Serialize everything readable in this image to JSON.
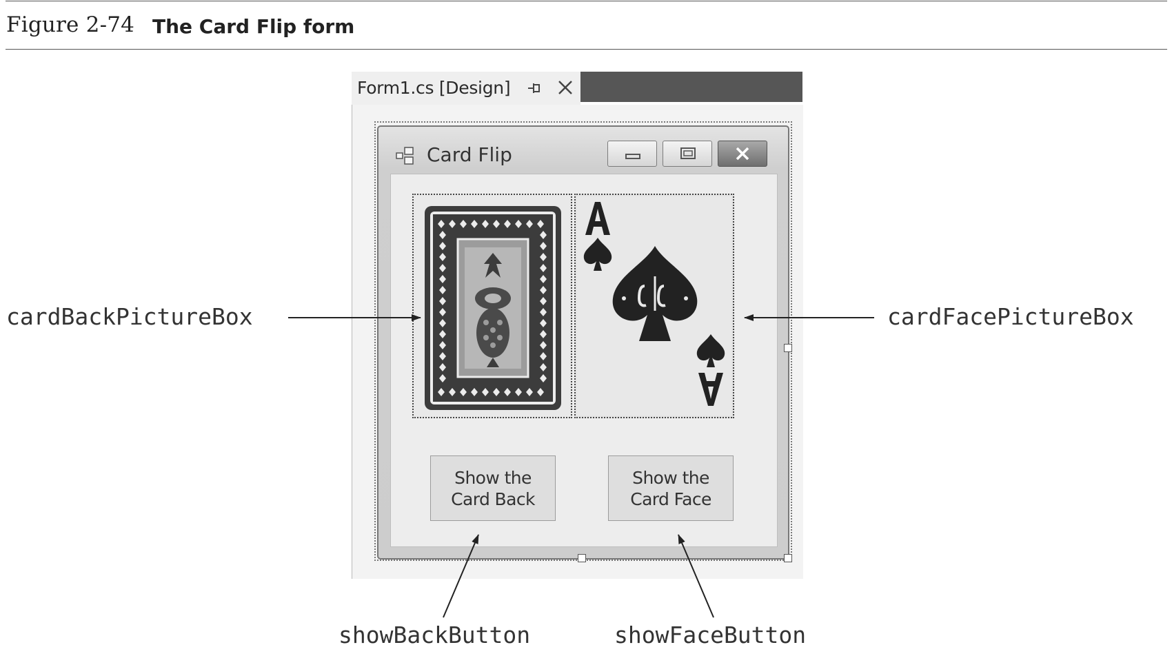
{
  "figure": {
    "number": "Figure 2-74",
    "title": "The Card Flip form"
  },
  "designer": {
    "tab_label": "Form1.cs [Design]",
    "pin_icon": "pin-icon",
    "close_icon": "close-icon"
  },
  "form": {
    "title": "Card Flip",
    "app_icon": "form-icon",
    "caption_buttons": [
      "minimize",
      "maximize",
      "close"
    ],
    "picture_boxes": {
      "back": "card-back-image",
      "face": "ace-of-spades-image"
    },
    "buttons": {
      "show_back_line1": "Show the",
      "show_back_line2": "Card Back",
      "show_face_line1": "Show the",
      "show_face_line2": "Card Face"
    }
  },
  "callouts": {
    "card_back_picture_box": "cardBackPictureBox",
    "card_face_picture_box": "cardFacePictureBox",
    "show_back_button": "showBackButton",
    "show_face_button": "showFaceButton"
  },
  "colors": {
    "tab_dark": "#565656",
    "card_back_border": "#3a3a3a",
    "card_back_inner": "#9a9a9a"
  }
}
